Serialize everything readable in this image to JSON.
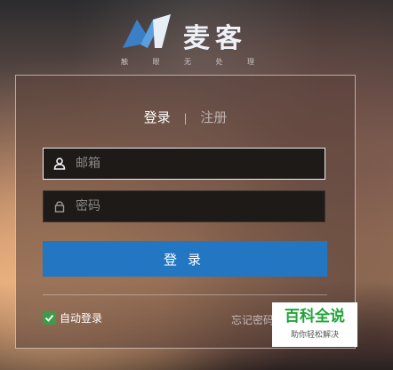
{
  "brand": {
    "name": "麦客",
    "tagline": [
      "触",
      "眼",
      "无",
      "处",
      "理"
    ]
  },
  "tabs": {
    "login": "登录",
    "separator": "|",
    "register": "注册"
  },
  "form": {
    "email_placeholder": "邮箱",
    "password_placeholder": "密码",
    "email_icon": "user-icon",
    "password_icon": "lock-icon"
  },
  "actions": {
    "login_label": "登录",
    "remember_label": "自动登录",
    "remember_checked": true,
    "forgot_label": "忘记密码"
  },
  "watermark": {
    "title": "百科全说",
    "subtitle": "助你轻松解决"
  },
  "colors": {
    "primary": "#2377c2",
    "checkbox": "#3e9b4b",
    "watermark_green": "#21a33b"
  }
}
